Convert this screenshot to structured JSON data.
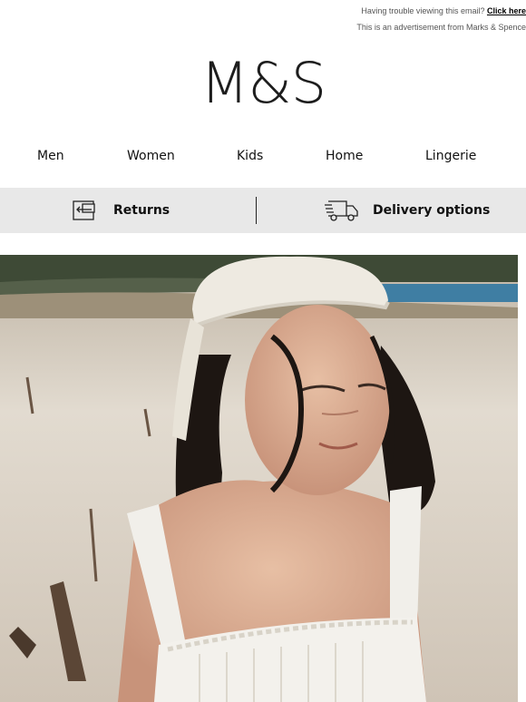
{
  "preheader": {
    "trouble_text": "Having trouble viewing this email? ",
    "click_here": "Click here",
    "advert_text": "This is an advertisement from Marks & Spence"
  },
  "brand": {
    "logo": "M&S"
  },
  "nav": {
    "items": [
      {
        "label": "Men"
      },
      {
        "label": "Women"
      },
      {
        "label": "Kids"
      },
      {
        "label": "Home"
      },
      {
        "label": "Lingerie"
      }
    ]
  },
  "services": {
    "returns": {
      "label": "Returns",
      "icon": "returns-icon"
    },
    "delivery": {
      "label": "Delivery options",
      "icon": "delivery-truck-icon"
    }
  },
  "hero": {
    "image": "hero-model-photo"
  },
  "colors": {
    "service_bar_bg": "#e8e8e8",
    "text": "#111111"
  }
}
